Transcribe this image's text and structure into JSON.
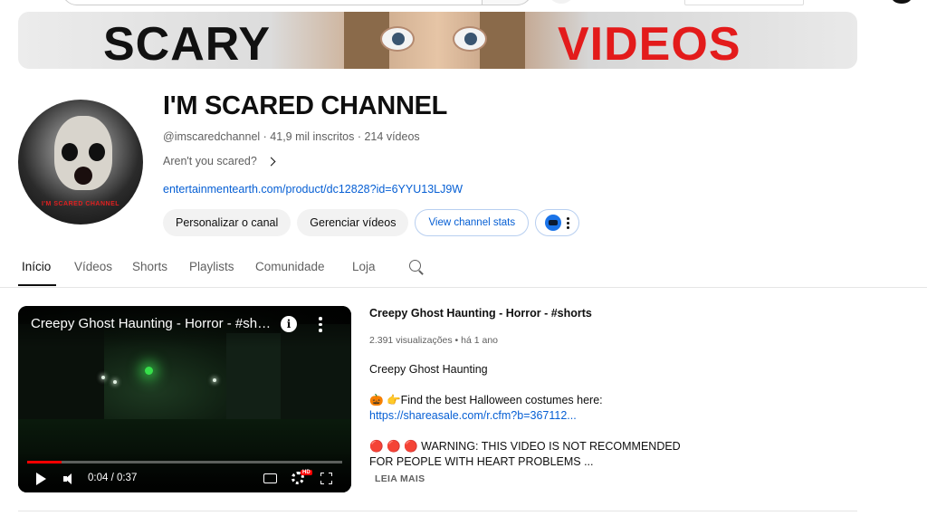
{
  "banner": {
    "left_text": "SCARY",
    "right_text": "VIDEOS"
  },
  "channel": {
    "avatar_text": "I'M SCARED CHANNEL",
    "name": "I'M SCARED CHANNEL",
    "meta": "@imscaredchannel · 41,9 mil inscritos · 214 vídeos",
    "tagline": "Aren't you scared?",
    "link": "entertainmentearth.com/product/dc12828?id=6YYU13LJ9W"
  },
  "buttons": {
    "customize": "Personalizar o canal",
    "manage": "Gerenciar vídeos",
    "stats": "View channel stats"
  },
  "tabs": [
    {
      "label": "Início",
      "active": true
    },
    {
      "label": "Vídeos"
    },
    {
      "label": "Shorts"
    },
    {
      "label": "Playlists"
    },
    {
      "label": "Comunidade"
    },
    {
      "label": "Loja"
    }
  ],
  "player": {
    "title": "Creepy Ghost Haunting - Horror - #shorts",
    "time": "0:04 / 0:37",
    "progress_fraction": 0.108,
    "hd_badge": "HD"
  },
  "video": {
    "title": "Creepy Ghost Haunting - Horror - #shorts",
    "meta": "2.391 visualizações • há 1 ano",
    "desc_line1": "Creepy Ghost Haunting",
    "desc_line2": "🎃 👉Find the best Halloween costumes here:",
    "desc_link": "https://shareasale.com/r.cfm?b=367112...",
    "desc_line3": "🔴 🔴 🔴 WARNING: THIS VIDEO IS NOT RECOMMENDED FOR PEOPLE WITH HEART PROBLEMS ...",
    "read_more": "LEIA MAIS"
  },
  "colors": {
    "accent_link": "#065fd4",
    "banner_red": "#e31b1b",
    "progress_red": "#ff0000"
  }
}
